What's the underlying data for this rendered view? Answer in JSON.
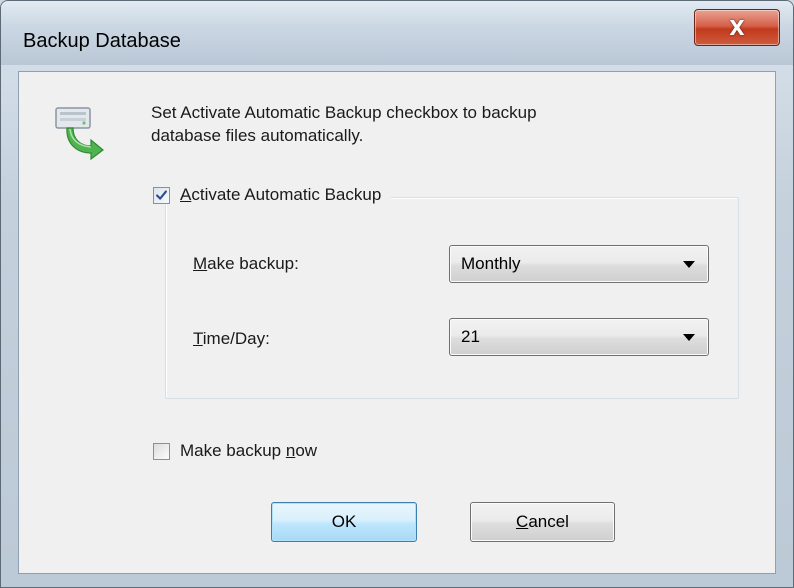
{
  "window": {
    "title": "Backup Database",
    "close_label": "X"
  },
  "icons": {
    "app": "backup-arrow-icon",
    "close": "close-icon",
    "dropdown": "chevron-down-icon",
    "check": "checkmark-icon"
  },
  "description": {
    "line1": "Set Activate Automatic Backup checkbox to backup",
    "line2": "database files automatically."
  },
  "auto_backup": {
    "label_first": "A",
    "label_rest": "ctivate Automatic Backup",
    "checked": true
  },
  "make_backup": {
    "label_first": "M",
    "label_rest": "ake backup:",
    "value": "Monthly"
  },
  "time_day": {
    "label_first": "T",
    "label_rest": "ime/Day:",
    "value": "21"
  },
  "backup_now": {
    "label_pre": "Make backup ",
    "label_underlined": "n",
    "label_post": "ow",
    "checked": false
  },
  "buttons": {
    "ok_label": "OK",
    "cancel_first": "C",
    "cancel_rest": "ancel"
  },
  "colors": {
    "close_button": "#c23a1e",
    "default_button_border": "#3c7fb1",
    "check_mark": "#2b4f8f",
    "icon_green": "#3aa33a"
  }
}
